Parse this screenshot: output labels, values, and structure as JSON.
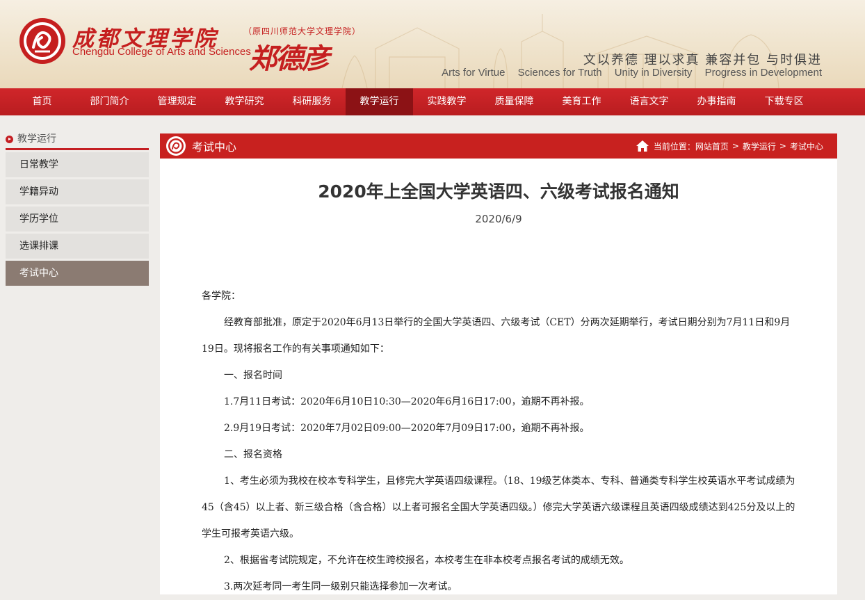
{
  "header": {
    "logo_cn": "成都文理学院",
    "logo_en": "Chengdu College of Arts and Sciences",
    "former_name": "（原四川师范大学文理学院）",
    "signature": "郑德彦",
    "motto_cn": "文以养德  理以求真  兼容并包  与时俱进",
    "motto_en": [
      "Arts for Virtue",
      "Sciences for Truth",
      "Unity in Diversity",
      "Progress in Development"
    ],
    "brand_color": "#c51f1f"
  },
  "nav": {
    "items": [
      {
        "label": "首页"
      },
      {
        "label": "部门简介"
      },
      {
        "label": "管理规定"
      },
      {
        "label": "教学研究"
      },
      {
        "label": "科研服务"
      },
      {
        "label": "教学运行"
      },
      {
        "label": "实践教学"
      },
      {
        "label": "质量保障"
      },
      {
        "label": "美育工作"
      },
      {
        "label": "语言文字"
      },
      {
        "label": "办事指南"
      },
      {
        "label": "下载专区"
      }
    ],
    "active": "教学运行"
  },
  "sidebar": {
    "title": "教学运行",
    "items": [
      {
        "label": "日常教学"
      },
      {
        "label": "学籍异动"
      },
      {
        "label": "学历学位"
      },
      {
        "label": "选课排课"
      },
      {
        "label": "考试中心"
      }
    ],
    "active": "考试中心"
  },
  "content": {
    "section_title": "考试中心",
    "breadcrumb": {
      "prefix": "当前位置：",
      "items": [
        "网站首页",
        "教学运行",
        "考试中心"
      ],
      "separator": ">"
    }
  },
  "article": {
    "title": "2020年上全国大学英语四、六级考试报名通知",
    "date": "2020/6/9",
    "greeting": "各学院：",
    "paragraphs": [
      "经教育部批准，原定于2020年6月13日举行的全国大学英语四、六级考试（CET）分两次延期举行，考试日期分别为7月11日和9月19日。现将报名工作的有关事项通知如下：",
      "一、报名时间",
      "1.7月11日考试：2020年6月10日10:30—2020年6月16日17:00，逾期不再补报。",
      "2.9月19日考试：2020年7月02日09:00—2020年7月09日17:00，逾期不再补报。",
      "二、报名资格",
      "1、考生必须为我校在校本专科学生，且修完大学英语四级课程。（18、19级艺体类本、专科、普通类专科学生校英语水平考试成绩为45（含45）以上者、新三级合格（含合格）以上者可报名全国大学英语四级。）修完大学英语六级课程且英语四级成绩达到425分及以上的学生可报考英语六级。",
      "2、根据省考试院规定，不允许在校生跨校报名，本校考生在非本校考点报名考试的成绩无效。",
      "3.两次延考同一考生同一级别只能选择参加一次考试。"
    ]
  }
}
